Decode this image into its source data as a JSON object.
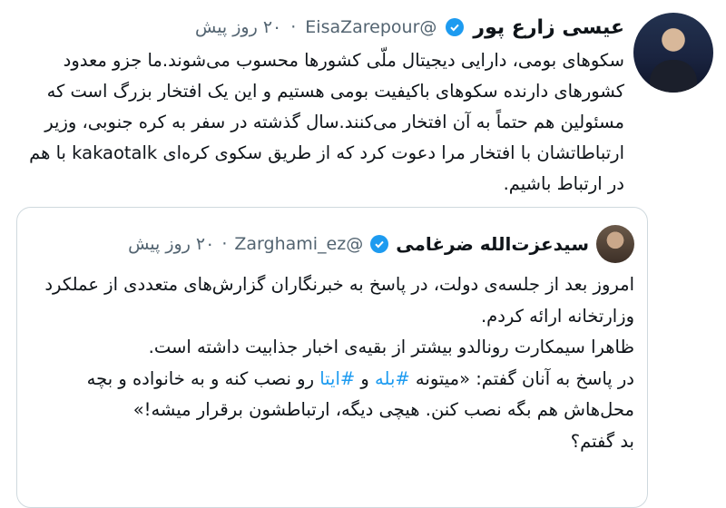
{
  "tweet": {
    "name": "عیسی زارع پور",
    "handle": "@EisaZarepour",
    "time": "۲۰ روز پیش",
    "separator": "·",
    "text": "سکوهای بومی، دارایی دیجیتال ملّی کشورها محسوب می‌شوند.ما جزو معدود کشورهای دارنده سکوهای باکیفیت بومی هستیم و این یک افتخار بزرگ است که مسئولین هم حتماً به آن افتخار می‌کنند.سال گذشته در سفر به کره جنوبی، وزیر ارتباطاتشان با افتخار مرا دعوت کرد که از طریق سکوی کره‌ای kakaotalk با هم در ارتباط باشیم."
  },
  "quote": {
    "name": "سیدعزت‌الله ضرغامی",
    "handle": "@Zarghami_ez",
    "time": "۲۰ روز پیش",
    "separator": "·",
    "line1": "امروز بعد از جلسه‌ی دولت، در پاسخ به خبرنگاران گزارش‌های متعددی از عملکرد وزارتخانه ارائه کردم.",
    "line2": "ظاهرا سیمکارت رونالدو بیشتر از بقیه‌ی اخبار جذابیت داشته است.",
    "line3_a": "در پاسخ به آنان گفتم: «میتونه ",
    "hashtag1": "#بله",
    "line3_b": " و ",
    "hashtag2": "#ایتا",
    "line3_c": " رو نصب کنه و به خانواده و بچه محل‌هاش هم بگه نصب کنن. هیچی دیگه، ارتباطشون برقرار میشه!»",
    "line4": "بد گفتم؟"
  },
  "colors": {
    "verified": "#1d9bf0",
    "hashtag": "#1d9bf0",
    "secondary_text": "#536471"
  },
  "icons": {
    "verified": "verified-badge-icon"
  }
}
